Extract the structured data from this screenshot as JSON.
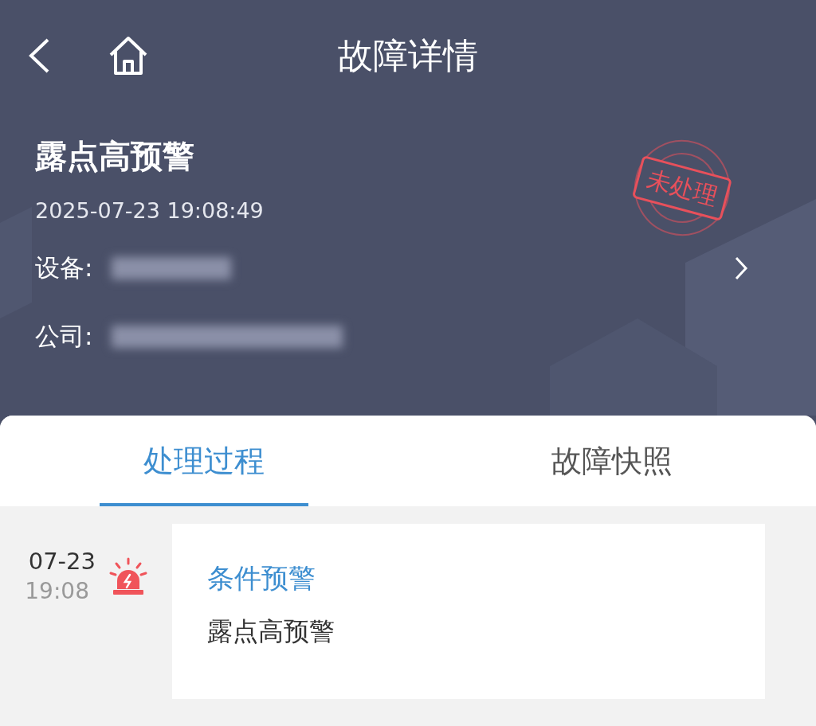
{
  "nav": {
    "title": "故障详情"
  },
  "fault": {
    "name": "露点高预警",
    "time": "2025-07-23 19:08:49",
    "status": {
      "label": "未处理",
      "kind": "pending"
    },
    "fields": [
      {
        "label": "设备:",
        "blurred": true,
        "link": true
      },
      {
        "label": "公司:",
        "blurred": true,
        "link": false
      }
    ]
  },
  "tabs": [
    {
      "label": "处理过程",
      "selected": true
    },
    {
      "label": "故障快照",
      "selected": false
    }
  ],
  "timeline": [
    {
      "date": "07-23",
      "time": "19:08",
      "kind": "alert",
      "title": "条件预警",
      "detail": "露点高预警"
    }
  ]
}
